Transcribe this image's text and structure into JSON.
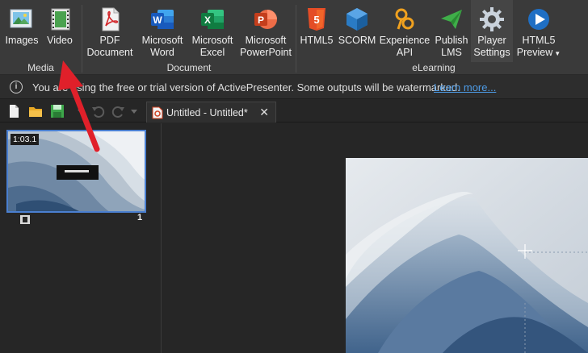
{
  "ribbon": {
    "media": {
      "label": "Media",
      "images": {
        "label": "Images",
        "icon": "images-icon"
      },
      "video": {
        "label": "Video",
        "icon": "video-icon"
      }
    },
    "document": {
      "label": "Document",
      "pdf": {
        "line1": "PDF",
        "line2": "Document",
        "icon": "pdf-icon"
      },
      "word": {
        "line1": "Microsoft",
        "line2": "Word",
        "icon": "word-icon"
      },
      "excel": {
        "line1": "Microsoft",
        "line2": "Excel",
        "icon": "excel-icon"
      },
      "powerpoint": {
        "line1": "Microsoft",
        "line2": "PowerPoint",
        "icon": "powerpoint-icon"
      }
    },
    "elearning": {
      "label": "eLearning",
      "html5": {
        "label": "HTML5",
        "icon": "html5-icon"
      },
      "scorm": {
        "label": "SCORM",
        "icon": "scorm-icon"
      },
      "xapi": {
        "line1": "Experience",
        "line2": "API",
        "icon": "xapi-icon"
      },
      "lms": {
        "line1": "Publish",
        "line2": "LMS",
        "icon": "publish-lms-icon"
      },
      "player": {
        "line1": "Player",
        "line2": "Settings",
        "icon": "gear-icon"
      },
      "preview": {
        "line1": "HTML5",
        "line2": "Preview",
        "icon": "play-icon"
      }
    }
  },
  "infobar": {
    "message": "You are using the free or trial version of ActivePresenter. Some outputs will be watermarked.",
    "link": "Learn more..."
  },
  "tabs": {
    "doc_title": "Untitled - Untitled*"
  },
  "slides": {
    "duration": "1:03.1",
    "number": "1"
  },
  "colors": {
    "accent": "#4a7fd0",
    "arrow": "#e0202a",
    "link": "#4d9be6"
  }
}
